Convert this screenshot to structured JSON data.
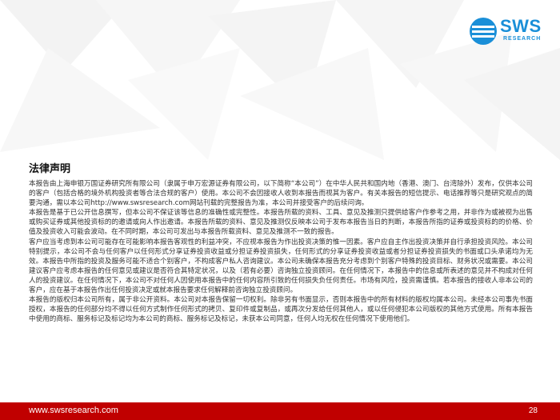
{
  "brand": {
    "logo_text": "SWS",
    "logo_subtext": "RESEARCH",
    "primary_color": "#1a8fd8",
    "footer_color": "#c00000"
  },
  "title": "法律声明",
  "paragraphs": [
    "本报告由上海申银万国证券研究所有限公司（隶属于申万宏源证券有限公司，以下简称“本公司”）在中华人民共和国内地（香港、澳门、台湾除外）发布，仅供本公司的客户（包括合格的境外机构投资者等合法合规的客户）使用。本公司不会因接收人收到本报告而视其为客户。有关本报告的短信提示、电话推荐等只是研究观点的简要沟通，需以本公司http://www.swsresearch.com网站刊载的完整报告为准，本公司并接受客户的后续问询。",
    "本报告是基于已公开信息撰写，但本公司不保证该等信息的准确性或完整性。本报告所载的资料、工具、意见及推测只提供给客户作参考之用，并非作为或被视为出售或购买证券或其他投资标的的邀请或向人作出邀请。本报告所载的资料、意见及推测仅反映本公司于发布本报告当日的判断，本报告所指的证券或投资标的的价格、价值及投资收入可能会波动。在不同时期，本公司可发出与本报告所载资料、意见及推测不一致的报告。",
    "客户应当考虑到本公司可能存在可能影响本报告客观性的利益冲突，不应视本报告为作出投资决策的惟一因素。客户应自主作出投资决策并自行承担投资风险。本公司特别提示，本公司不会与任何客户以任何形式分享证券投资收益或分担证券投资损失，任何形式的分享证券投资收益或者分担证券投资损失的书面或口头承诺均为无效。本报告中所指的投资及服务可能不适合个别客户，不构成客户私人咨询建议。本公司未确保本报告充分考虑到个别客户特殊的投资目标、财务状况或需要。本公司建议客户应考虑本报告的任何意见或建议是否符合其特定状况，以及（若有必要）咨询独立投资顾问。在任何情况下，本报告中的信息或所表述的意见并不构成对任何人的投资建议。在任何情况下，本公司不对任何人因使用本报告中的任何内容所引致的任何损失负任何责任。市场有风险，投资需谨慎。若本报告的接收人非本公司的客户，应在基于本报告作出任何投资决定或就本报告要求任何解释前咨询独立投资顾问。",
    "本报告的版权归本公司所有，属于非公开资料。本公司对本报告保留一切权利。除非另有书面显示，否则本报告中的所有材料的版权均属本公司。未经本公司事先书面授权，本报告的任何部分均不得以任何方式制作任何形式的拷贝、复印件或复制品，或再次分发给任何其他人，或以任何侵犯本公司版权的其他方式使用。所有本报告中使用的商标、服务标记及标记均为本公司的商标、服务标记及标记，未获本公司同意，任何人均无权在任何情况下使用他们。"
  ],
  "footer": {
    "url": "www.swsresearch.com",
    "page_number": "28"
  }
}
